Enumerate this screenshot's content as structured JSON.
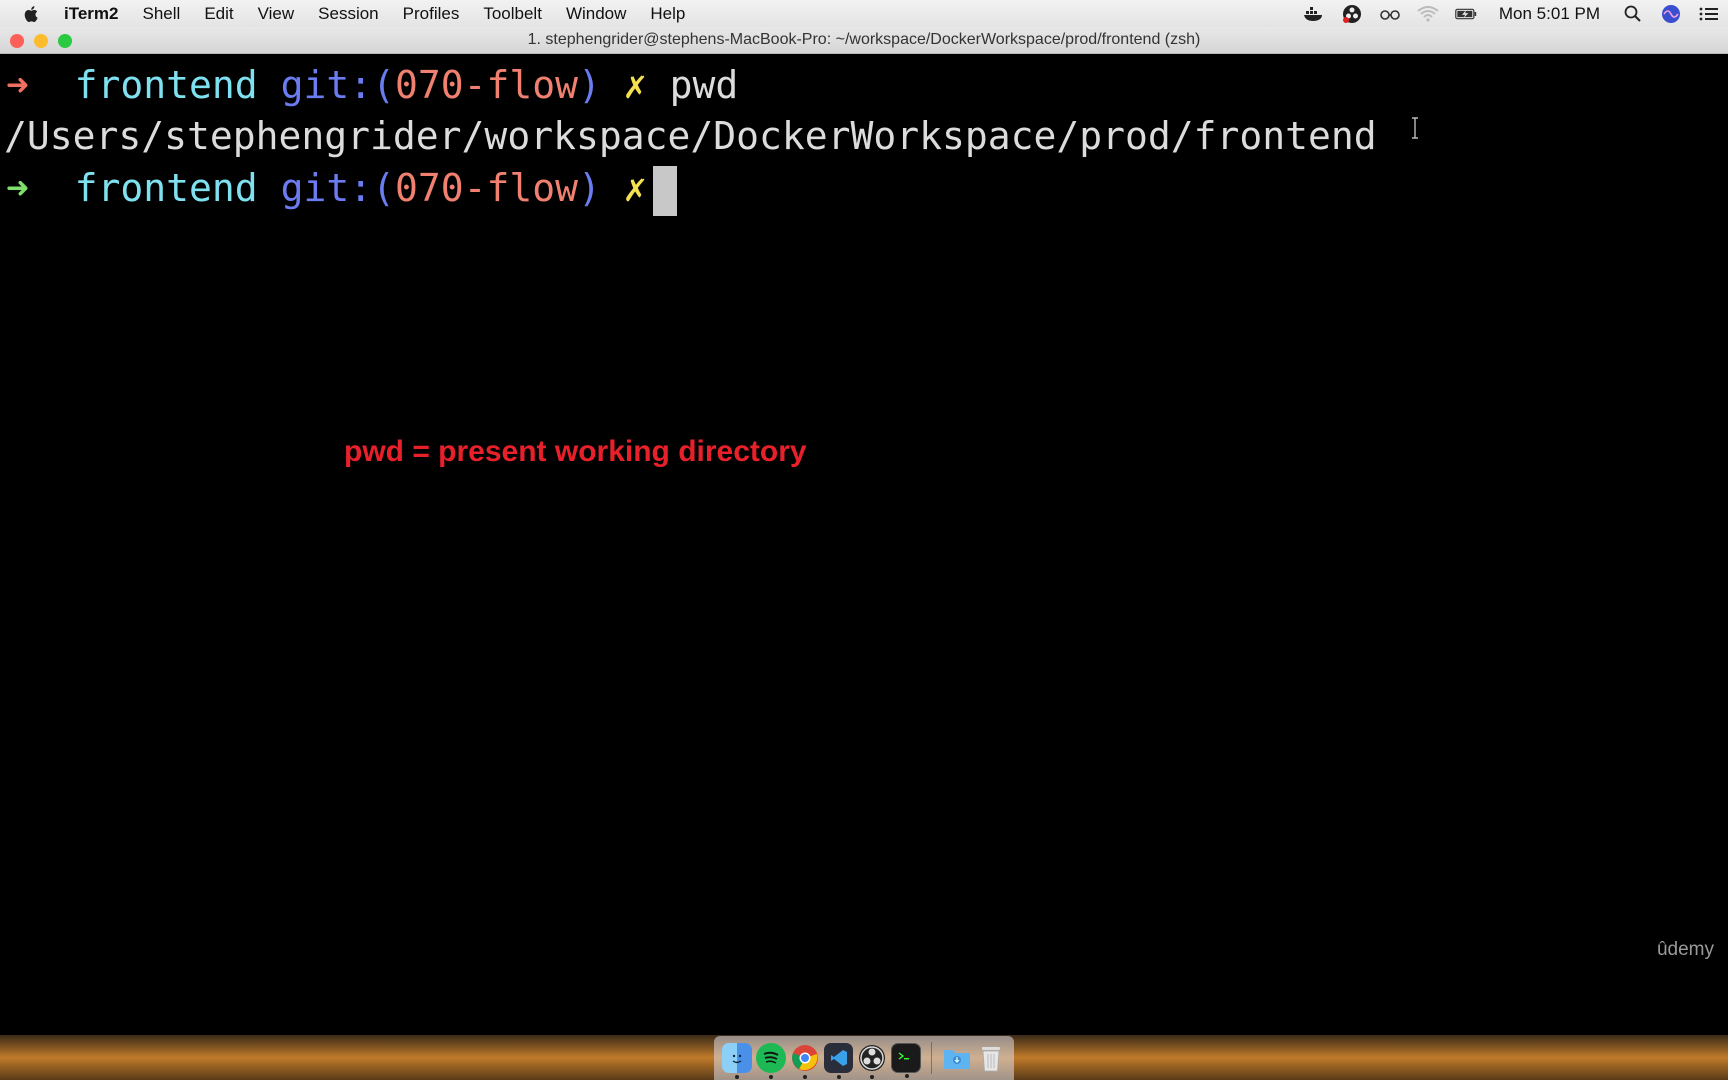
{
  "menubar": {
    "app_name": "iTerm2",
    "items": [
      "Shell",
      "Edit",
      "View",
      "Session",
      "Profiles",
      "Toolbelt",
      "Window",
      "Help"
    ],
    "clock": "Mon 5:01 PM",
    "status_icons": [
      "docker-icon",
      "obs-icon",
      "glasses-icon",
      "wifi-icon",
      "battery-icon",
      "search-icon",
      "siri-icon",
      "notification-center-icon"
    ]
  },
  "window": {
    "title": "1. stephengrider@stephens-MacBook-Pro: ~/workspace/DockerWorkspace/prod/frontend (zsh)"
  },
  "terminal": {
    "prompt_arrow": "➜",
    "directory": "frontend",
    "git_label": "git:(",
    "branch": "070-flow",
    "git_close": ")",
    "dirty_mark": "✗",
    "command": "pwd",
    "output": "/Users/stephengrider/workspace/DockerWorkspace/prod/frontend"
  },
  "annotation": "pwd = present working directory",
  "watermark": "ûdemy",
  "colors": {
    "arrow_error": "#f07060",
    "arrow_ok": "#7ee06a",
    "annotation": "#e8202a"
  },
  "dock": {
    "apps": [
      "finder-icon",
      "spotify-icon",
      "chrome-icon",
      "vscode-icon",
      "obs-icon",
      "terminal-icon",
      "downloads-folder-icon",
      "trash-icon"
    ]
  }
}
